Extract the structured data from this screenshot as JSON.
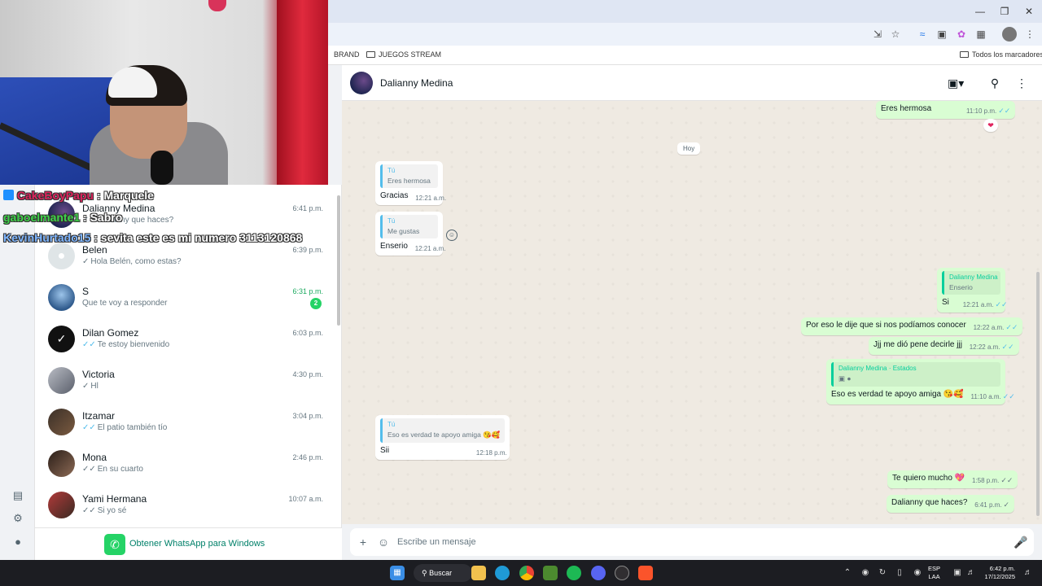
{
  "browser": {
    "bookmarks": [
      {
        "label": "BRAND"
      },
      {
        "label": "JUEGOS STREAM"
      }
    ],
    "all_bookmarks_label": "Todos los marcadores"
  },
  "chat_list": [
    {
      "name": "Dalianny Medina",
      "time": "6:41 p.m.",
      "preview": "Dalianny que haces?",
      "tick": "double-grey"
    },
    {
      "name": "Belen",
      "time": "6:39 p.m.",
      "preview": "Hola Belén, como estas?",
      "tick": "single"
    },
    {
      "name": "S",
      "time": "6:31 p.m.",
      "preview": "Que te voy a responder",
      "tick": "none",
      "unread": "2"
    },
    {
      "name": "Dilan Gomez",
      "time": "6:03 p.m.",
      "preview": "Te estoy bienvenido",
      "tick": "double-blue"
    },
    {
      "name": "Victoria",
      "time": "4:30 p.m.",
      "preview": "Hl",
      "tick": "single"
    },
    {
      "name": "Itzamar",
      "time": "3:04 p.m.",
      "preview": "El patio también tío",
      "tick": "double-blue"
    },
    {
      "name": "Mona",
      "time": "2:46 p.m.",
      "preview": "En su cuarto",
      "tick": "double-grey"
    },
    {
      "name": "Yami Hermana",
      "time": "10:07 a.m.",
      "preview": "Si yo sé",
      "tick": "double-grey"
    }
  ],
  "get_app_label": "Obtener WhatsApp para Windows",
  "chat": {
    "contact_name": "Dalianny Medina",
    "day_label": "Hoy",
    "messages": {
      "m_top": {
        "text": "Eres hermosa",
        "time": "11:10 p.m."
      },
      "m1": {
        "quote_author": "Tú",
        "quote_text": "Eres hermosa",
        "text": "Gracias",
        "time": "12:21 a.m."
      },
      "m2": {
        "quote_author": "Tú",
        "quote_text": "Me gustas",
        "text": "Enserio",
        "time": "12:21 a.m."
      },
      "m3": {
        "quote_author": "Dalianny Medina",
        "quote_text": "Enserio",
        "text": "Si",
        "time": "12:21 a.m."
      },
      "m4": {
        "text": "Por eso le dije que si nos podíamos conocer",
        "time": "12:22 a.m."
      },
      "m5": {
        "text": "Jjj me dió pene decirle jjj",
        "time": "12:22 a.m."
      },
      "m6": {
        "quote_author": "Dalianny Medina · Estados",
        "text": "Eso es verdad te apoyo amiga 😘🥰",
        "time": "11:10 a.m."
      },
      "m7": {
        "quote_author": "Tú",
        "quote_text": "Eso es verdad te apoyo amiga 😘🥰",
        "text": "Sii",
        "time": "12:18 p.m."
      },
      "m8": {
        "text": "Te quiero mucho 💖",
        "time": "1:58 p.m."
      },
      "m9": {
        "text": "Dalianny que haces?",
        "time": "6:41 p.m."
      }
    },
    "composer_placeholder": "Escribe un mensaje"
  },
  "stream_overlay": [
    {
      "user": "CakeBoyPapu",
      "message": ": Marquele",
      "color": "#e0245e"
    },
    {
      "user": "gaboelmante1",
      "message": ": Sabro",
      "color": "#3fd34a"
    },
    {
      "user": "KevinHurtado15",
      "message": ": sevita este es mi numero 3113120868",
      "color": "#7fb6ff"
    }
  ],
  "taskbar": {
    "search_label": "Buscar",
    "lang_line1": "ESP",
    "lang_line2": "LAA",
    "time": "6:42 p.m.",
    "date": "17/12/2025"
  },
  "colors": {
    "accent": "#25d366",
    "outgoing_bubble": "#d9fdd3",
    "read_tick": "#53bdeb"
  }
}
